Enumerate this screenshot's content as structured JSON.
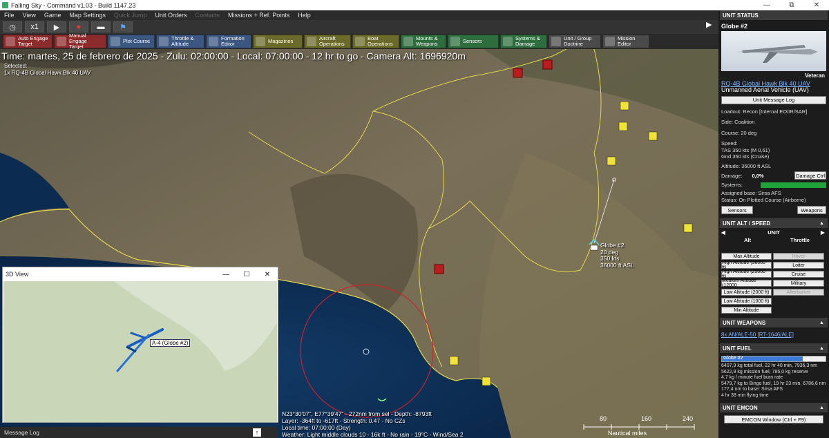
{
  "window": {
    "title": "Falling Sky - Command v1.03 - Build 1147.23",
    "min": "—",
    "max": "⧉",
    "close": "✕"
  },
  "menu": [
    {
      "label": "File",
      "disabled": false
    },
    {
      "label": "View",
      "disabled": false
    },
    {
      "label": "Game",
      "disabled": false
    },
    {
      "label": "Map Settings",
      "disabled": false
    },
    {
      "label": "Quick Jump",
      "disabled": true
    },
    {
      "label": "Unit Orders",
      "disabled": false
    },
    {
      "label": "Contacts",
      "disabled": true
    },
    {
      "label": "Missions + Ref. Points",
      "disabled": false
    },
    {
      "label": "Help",
      "disabled": false
    }
  ],
  "sim": {
    "speed": "x1",
    "play": "▶",
    "record": "●"
  },
  "toolbar": [
    {
      "label": "Auto Engage Target",
      "style": "red",
      "icon": "crosshair-icon"
    },
    {
      "label": "Manual Engage Target",
      "style": "red",
      "icon": "target-icon"
    },
    {
      "label": "Plot Course",
      "style": "blue",
      "icon": "plot-course-icon"
    },
    {
      "label": "Throttle & Altitude",
      "style": "blue",
      "icon": "throttle-icon"
    },
    {
      "label": "Formation Editor",
      "style": "blue",
      "icon": "formation-icon"
    },
    {
      "label": "Magazines",
      "style": "olive",
      "icon": "magazines-icon"
    },
    {
      "label": "Aircraft Operations",
      "style": "olive",
      "icon": "aircraft-icon"
    },
    {
      "label": "Boat Operations",
      "style": "olive",
      "icon": "boat-icon"
    },
    {
      "label": "Mounts & Weapons",
      "style": "green",
      "icon": "weapons-icon"
    },
    {
      "label": "Sensors",
      "style": "green",
      "icon": "sensors-icon"
    },
    {
      "label": "Systems & Damage",
      "style": "green",
      "icon": "systems-icon"
    },
    {
      "label": "Unit / Group Doctrine",
      "style": "dark",
      "icon": "doctrine-icon"
    },
    {
      "label": "Mission Editor",
      "style": "dark",
      "icon": "mission-editor-icon"
    }
  ],
  "hud": {
    "time": "Time: martes, 25 de febrero de 2025 - Zulu: 02:00:00 - Local: 07:00:00 - 12 hr to go - Camera Alt: 1696920m",
    "selected_label": "Selected:",
    "selected_unit": "1x RQ-4B Global Hawk Blk 40 UAV"
  },
  "map_unit": {
    "name": "Globe #2",
    "course": "20 deg",
    "speed": "350 kts",
    "alt": "36000 ft ASL"
  },
  "status": {
    "coords": "N23°30'07\", E77°39'47\" - 272nm from sel - Depth: -8793ft",
    "layer": "Layer: -364ft to -617ft - Strength: 0.47 - No CZs",
    "local": "Local time: 07:00:00 (Day)",
    "weather": "Weather: Light middle clouds 10 - 16k ft - No rain - 19°C - Wind/Sea 2"
  },
  "scale": {
    "ticks": [
      "80",
      "160",
      "240"
    ],
    "unit": "Nautical miles"
  },
  "view3d": {
    "title": "3D View",
    "label": "A-4 (Globe #2)"
  },
  "msglog": {
    "label": "Message Log",
    "up": "↑"
  },
  "panel": {
    "status_title": "UNIT STATUS",
    "unit_name": "Globe #2",
    "rank": "Veteran",
    "type_link": "RQ-4B Global Hawk Blk 40 UAV",
    "type_desc": "Unmanned Aerial Vehicle (UAV)",
    "msg_log_btn": "Unit Message Log",
    "loadout": "Loadout: Recon [Internal EO/IR/SAR]",
    "side": "Side: Coalition",
    "course": "Course: 20 deg",
    "speed_hdr": "Speed:",
    "tas": "TAS 350 kts (M 0,61)",
    "gnd": "Gnd 350 kts (Cruise)",
    "altitude": "Altitude: 36000 ft ASL",
    "damage_label": "Damage:",
    "damage_val": "0,0%",
    "damage_btn": "Damage Ctrl",
    "systems_label": "Systems:",
    "base": "Assigned base: Sirsa AFS",
    "status_line": "Status: On Plotted Course (Airborne)",
    "sensors_btn": "Sensors",
    "weapons_btn": "Weapons",
    "alt_title": "UNIT ALT / SPEED",
    "unit_hdr": "UNIT",
    "alt_col": "Alt",
    "thr_col": "Throttle",
    "alt_buttons": [
      {
        "alt": "Max Altitude",
        "thr": "Hover",
        "thr_disabled": true
      },
      {
        "alt": "High Altitude (36000 ft)",
        "thr": "Loiter",
        "thr_disabled": false
      },
      {
        "alt": "High Altitude (25000 ft)",
        "thr": "Cruise",
        "thr_disabled": false
      },
      {
        "alt": "Medium Altitude (12000",
        "thr": "Military",
        "thr_disabled": false
      },
      {
        "alt": "Low Altitude (2000 ft)",
        "thr": "Afterburner",
        "thr_disabled": true
      },
      {
        "alt": "Low Altitude (1000 ft)",
        "thr": "",
        "thr_disabled": true
      },
      {
        "alt": "Min Altitude",
        "thr": "",
        "thr_disabled": true
      }
    ],
    "weapons_title": "UNIT WEAPONS",
    "weapon_link": "8x AN/ALE-50 [RT-1646/ALE]",
    "fuel_title": "UNIT FUEL",
    "fuel_bar_label": "Globe #2",
    "fuel_fraction": 0.78,
    "fuel_lines": [
      "6407,9 kg total fuel, 22 hr 40 min, 7936,3 nm",
      "5622,9 kg mission fuel, 785,0 kg reserve",
      "4,7 kg / minute fuel burn rate",
      "5479,7 kg to Bingo fuel, 19 hr 23 min, 6786,6 nm",
      "177,4 nm to base: Sirsa AFS",
      "4 hr 38 min flying time"
    ],
    "emcon_title": "UNIT EMCON",
    "emcon_btn": "EMCON Window (Ctrl + F9)"
  }
}
